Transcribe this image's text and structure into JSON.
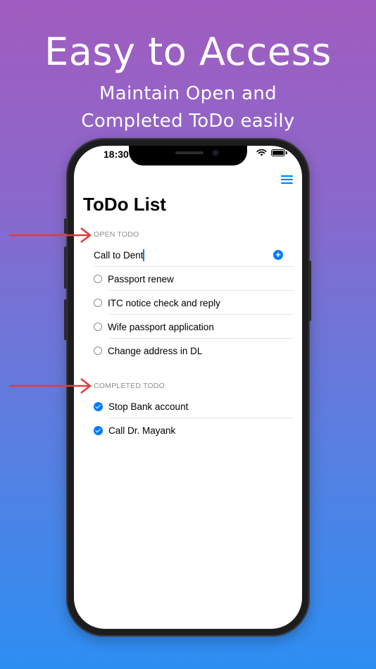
{
  "promo": {
    "headline": "Easy to Access",
    "subline_1": "Maintain Open and",
    "subline_2": "Completed ToDo easily"
  },
  "status_bar": {
    "time": "18:30"
  },
  "app": {
    "title": "ToDo List",
    "open_section_label": "OPEN TODO",
    "completed_section_label": "COMPLETED TODO",
    "new_todo_value": "Call to Dentist",
    "open_todos": [
      "Passport renew",
      "ITC notice check and reply",
      "Wife passport application",
      "Change address in DL"
    ],
    "completed_todos": [
      "Stop Bank account",
      "Call Dr. Mayank"
    ]
  },
  "colors": {
    "accent": "#007aff",
    "arrow": "#e5393b",
    "background_top": "#a15cbf",
    "background_bottom": "#2d8ef2"
  },
  "icons": [
    "menu-icon",
    "add-icon",
    "wifi-icon",
    "battery-icon",
    "radio-icon",
    "checkmark-icon",
    "arrow-icon"
  ]
}
